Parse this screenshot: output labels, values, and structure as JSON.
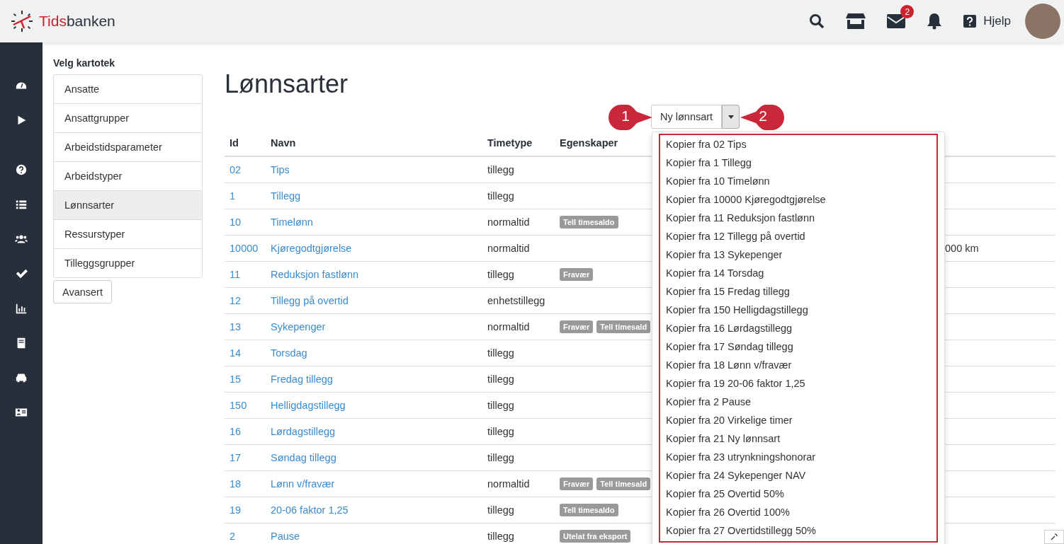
{
  "header": {
    "logo_red": "Tids",
    "logo_dark": "banken",
    "mail_badge": "2",
    "help": "Hjelp"
  },
  "kartotek": {
    "title": "Velg kartotek",
    "items": [
      {
        "label": "Ansatte",
        "selected": false
      },
      {
        "label": "Ansattgrupper",
        "selected": false
      },
      {
        "label": "Arbeidstidsparameter",
        "selected": false
      },
      {
        "label": "Arbeidstyper",
        "selected": false
      },
      {
        "label": "Lønnsarter",
        "selected": true
      },
      {
        "label": "Ressurstyper",
        "selected": false
      },
      {
        "label": "Tilleggsgrupper",
        "selected": false
      }
    ],
    "advanced": "Avansert"
  },
  "page_title": "Lønnsarter",
  "new_button": "Ny lønnsart",
  "annotations": [
    {
      "label": "1"
    },
    {
      "label": "2"
    }
  ],
  "table": {
    "columns": [
      "Id",
      "Navn",
      "Timetype",
      "Egenskaper"
    ],
    "rows": [
      {
        "id": "02",
        "name": "Tips",
        "timetype": "tillegg",
        "tags": []
      },
      {
        "id": "1",
        "name": "Tillegg",
        "timetype": "tillegg",
        "tags": []
      },
      {
        "id": "10",
        "name": "Timelønn",
        "timetype": "normaltid",
        "tags": [
          "Tell timesaldo"
        ]
      },
      {
        "id": "10000",
        "name": "Kjøregodtgjørelse",
        "timetype": "normaltid",
        "tags": [],
        "column_5": "000 km"
      },
      {
        "id": "11",
        "name": "Reduksjon fastlønn",
        "timetype": "tillegg",
        "tags": [
          "Fravær"
        ]
      },
      {
        "id": "12",
        "name": "Tillegg på overtid",
        "timetype": "enhetstillegg",
        "tags": []
      },
      {
        "id": "13",
        "name": "Sykepenger",
        "timetype": "normaltid",
        "tags": [
          "Fravær",
          "Tell timesald"
        ]
      },
      {
        "id": "14",
        "name": "Torsdag",
        "timetype": "tillegg",
        "tags": []
      },
      {
        "id": "15",
        "name": "Fredag tillegg",
        "timetype": "tillegg",
        "tags": []
      },
      {
        "id": "150",
        "name": "Helligdagstillegg",
        "timetype": "tillegg",
        "tags": []
      },
      {
        "id": "16",
        "name": "Lørdagstillegg",
        "timetype": "tillegg",
        "tags": []
      },
      {
        "id": "17",
        "name": "Søndag tillegg",
        "timetype": "tillegg",
        "tags": []
      },
      {
        "id": "18",
        "name": "Lønn v/fravær",
        "timetype": "normaltid",
        "tags": [
          "Fravær",
          "Tell timesald"
        ]
      },
      {
        "id": "19",
        "name": "20-06 faktor 1,25",
        "timetype": "tillegg",
        "tags": [
          "Tell timesaldo"
        ]
      },
      {
        "id": "2",
        "name": "Pause",
        "timetype": "tillegg",
        "tags": [
          "Utelat fra eksport"
        ]
      }
    ]
  },
  "dropdown": [
    "Kopier fra 02 Tips",
    "Kopier fra 1 Tillegg",
    "Kopier fra 10 Timelønn",
    "Kopier fra 10000 Kjøregodtgjørelse",
    "Kopier fra 11 Reduksjon fastlønn",
    "Kopier fra 12 Tillegg på overtid",
    "Kopier fra 13 Sykepenger",
    "Kopier fra 14 Torsdag",
    "Kopier fra 15 Fredag tillegg",
    "Kopier fra 150 Helligdagstillegg",
    "Kopier fra 16 Lørdagstillegg",
    "Kopier fra 17 Søndag tillegg",
    "Kopier fra 18 Lønn v/fravær",
    "Kopier fra 19 20-06 faktor 1,25",
    "Kopier fra 2 Pause",
    "Kopier fra 20 Virkelige timer",
    "Kopier fra 21 Ny lønnsart",
    "Kopier fra 23 utrynkningshonorar",
    "Kopier fra 24 Sykepenger NAV",
    "Kopier fra 25 Overtid 50%",
    "Kopier fra 26 Overtid 100%",
    "Kopier fra 27 Overtidstillegg 50%"
  ]
}
